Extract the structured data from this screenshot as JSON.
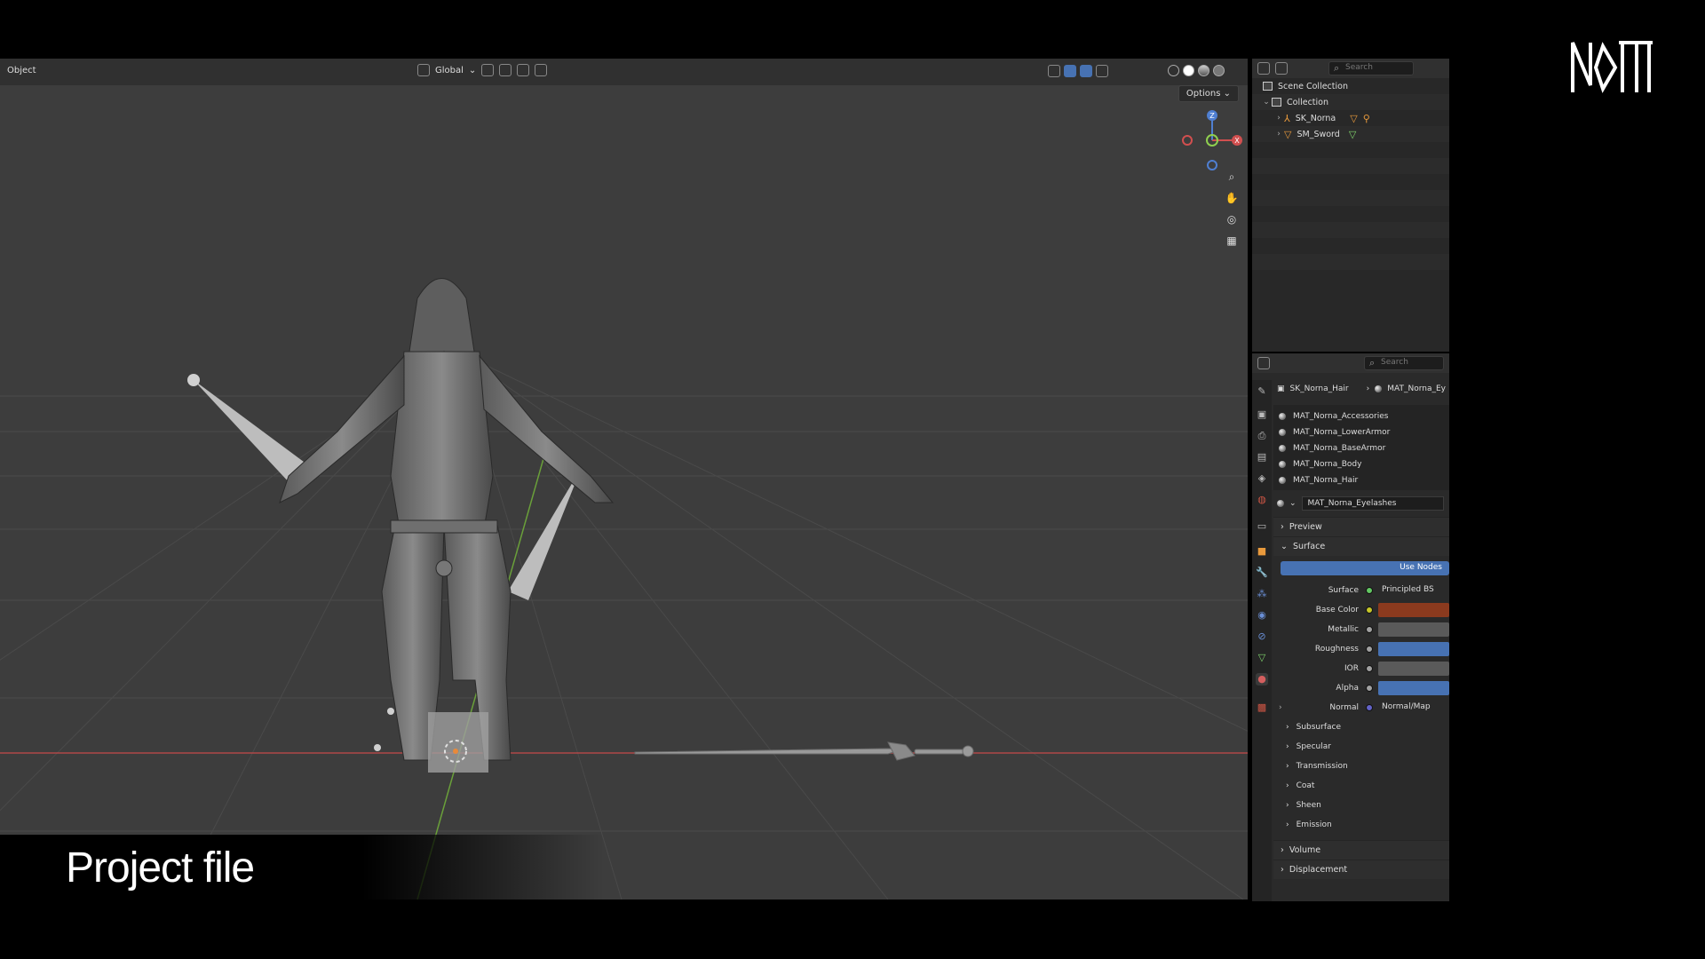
{
  "caption": "Project file",
  "viewport": {
    "mode": "Object",
    "orientation": "Global",
    "options_label": "Options",
    "gizmo": {
      "z": "Z",
      "x": "X"
    }
  },
  "outliner": {
    "search_placeholder": "Search",
    "items": [
      {
        "label": "Scene Collection"
      },
      {
        "label": "Collection"
      },
      {
        "label": "SK_Norna"
      },
      {
        "label": "SM_Sword"
      }
    ]
  },
  "properties": {
    "search_placeholder": "Search",
    "breadcrumb": {
      "object": "SK_Norna_Hair",
      "material": "MAT_Norna_Ey"
    },
    "slots": [
      "MAT_Norna_Accessories",
      "MAT_Norna_LowerArmor",
      "MAT_Norna_BaseArmor",
      "MAT_Norna_Body",
      "MAT_Norna_Hair"
    ],
    "active_material": "MAT_Norna_Eyelashes",
    "panels": {
      "preview": "Preview",
      "surface": "Surface",
      "volume": "Volume",
      "displacement": "Displacement"
    },
    "use_nodes": "Use Nodes",
    "surface_rows": [
      {
        "label": "Surface",
        "value": "Principled BS",
        "socket": "#63c763",
        "bar": "#2a2a2a"
      },
      {
        "label": "Base Color",
        "value": "",
        "socket": "#c7c729",
        "bar": "#8b3a1e"
      },
      {
        "label": "Metallic",
        "value": "",
        "socket": "#a1a1a1",
        "bar": "#5a5a5a"
      },
      {
        "label": "Roughness",
        "value": "",
        "socket": "#a1a1a1",
        "bar": "#4772b3"
      },
      {
        "label": "IOR",
        "value": "",
        "socket": "#a1a1a1",
        "bar": "#5a5a5a"
      },
      {
        "label": "Alpha",
        "value": "",
        "socket": "#a1a1a1",
        "bar": "#4772b3"
      },
      {
        "label": "Normal",
        "value": "Normal/Map",
        "socket": "#6363c7",
        "bar": "#2a2a2a"
      }
    ],
    "sub_panels": [
      "Subsurface",
      "Specular",
      "Transmission",
      "Coat",
      "Sheen",
      "Emission"
    ]
  }
}
